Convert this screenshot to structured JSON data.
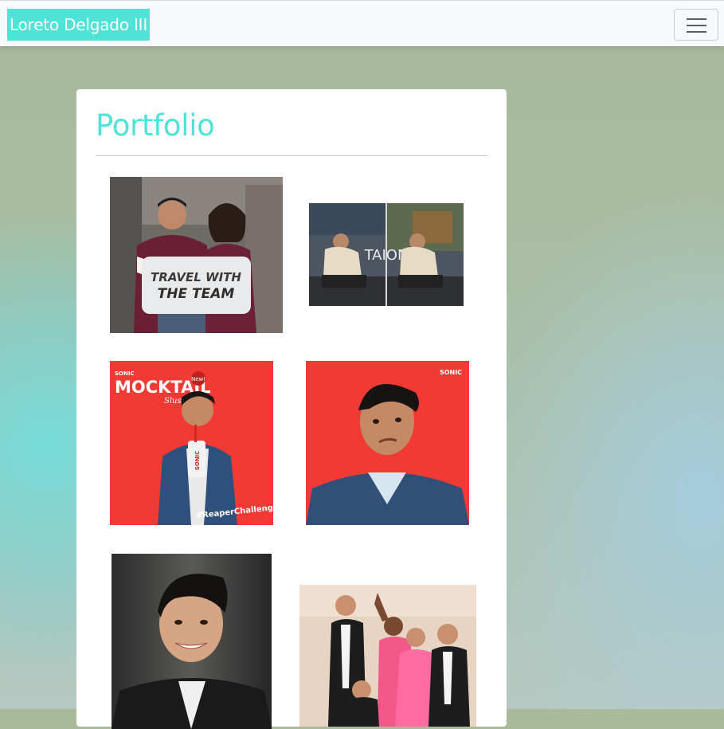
{
  "navbar": {
    "brand": "Loreto Delgado III",
    "toggler_icon": "hamburger-menu-icon"
  },
  "portfolio": {
    "title": "Portfolio",
    "items": [
      {
        "name": "travel-with-the-team",
        "caption_line1": "TRAVEL WITH",
        "caption_line2": "THE TEAM"
      },
      {
        "name": "taion-shoot",
        "sign_text": "TAION"
      },
      {
        "name": "sonic-mocktail",
        "brand_small": "SONIC",
        "headline": "MOCKTAIL",
        "subline": "Slushes",
        "badge": "New!",
        "cup_text": "SONIC",
        "hashtag": "#ReaperChallenge"
      },
      {
        "name": "sonic-portrait",
        "logo": "SONIC"
      },
      {
        "name": "headshot"
      },
      {
        "name": "group-dance"
      }
    ]
  },
  "colors": {
    "accent": "#4fe3d7",
    "navbar_bg": "#f8f9fa",
    "sonic_red": "#f23a35"
  }
}
